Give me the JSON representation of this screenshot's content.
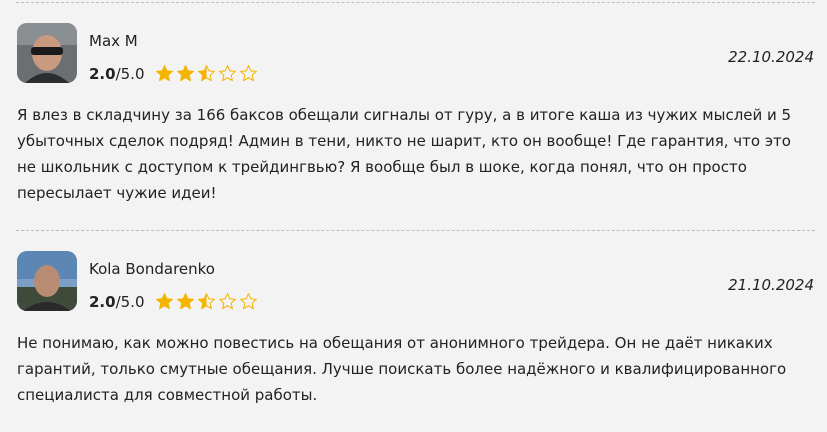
{
  "reviews": [
    {
      "author": "Max M",
      "score": "2.0",
      "max_score": "/5.0",
      "stars_rating": 2.5,
      "date": "22.10.2024",
      "text": "Я влез в складчину за 166 баксов обещали сигналы от гуру, а в итоге каша из чужих мыслей и 5 убыточных сделок подряд! Админ в тени, никто не шарит, кто он вообще! Где гарантия, что это не школьник с доступом к трейдингвью? Я вообще был в шоке, когда понял, что он просто пересылает чужие идеи!"
    },
    {
      "author": "Kola Bondarenko",
      "score": "2.0",
      "max_score": "/5.0",
      "stars_rating": 2.5,
      "date": "21.10.2024",
      "text": "Не понимаю, как можно повестись на обещания от анонимного трейдера. Он не даёт никаких гарантий, только смутные обещания. Лучше поискать более надёжного и квалифицированного специалиста для совместной работы."
    }
  ],
  "colors": {
    "star_fill": "#f5b400",
    "star_outline": "#f5b400",
    "background": "#f3f3f3",
    "divider": "#bdbdbd"
  }
}
